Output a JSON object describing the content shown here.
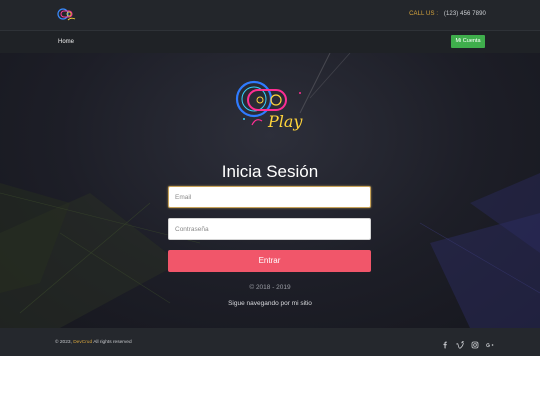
{
  "header": {
    "call_label": "CALL US :",
    "phone": "(123) 456 7890"
  },
  "nav": {
    "home": "Home",
    "account_button": "Mi Cuenta"
  },
  "login": {
    "title": "Inicia Sesión",
    "email_placeholder": "Email",
    "password_placeholder": "Contraseña",
    "submit_label": "Entrar",
    "years": "© 2018 - 2019",
    "keep_browsing": "Sigue navegando por mi sitio"
  },
  "logo": {
    "text": "Play"
  },
  "footer": {
    "copyright_prefix": "© 2023,",
    "brand": "DevCrud",
    "copyright_suffix": "All rights reserved",
    "socials": [
      "facebook-icon",
      "vimeo-icon",
      "instagram-icon",
      "google-plus-icon"
    ]
  },
  "colors": {
    "accent_green": "#3fae4c",
    "accent_pink": "#f1566a",
    "accent_gold": "#d6a43d"
  }
}
